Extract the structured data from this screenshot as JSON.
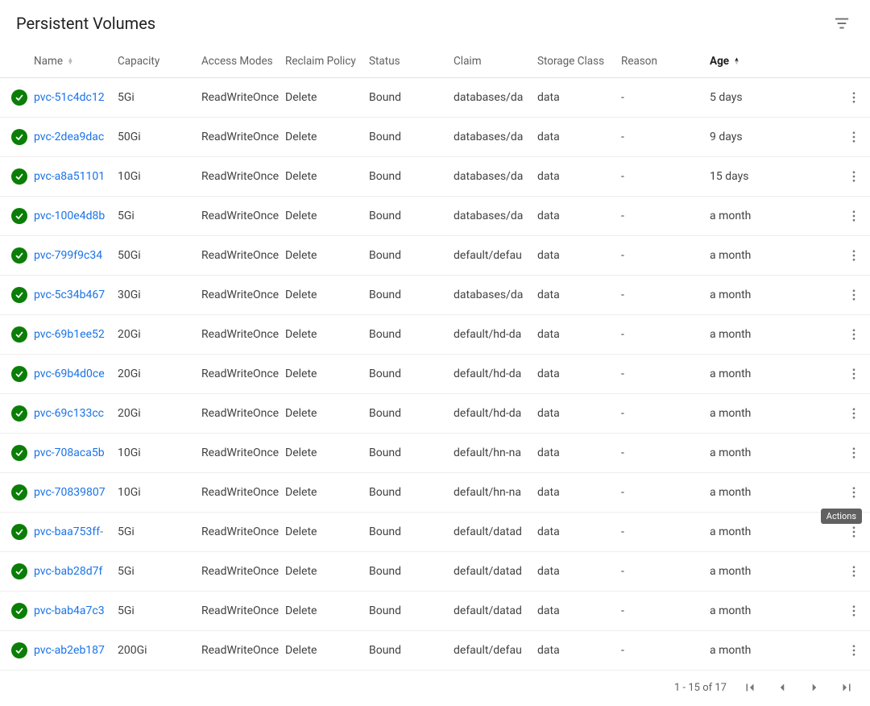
{
  "header": {
    "title": "Persistent Volumes"
  },
  "columns": {
    "name": "Name",
    "capacity": "Capacity",
    "access": "Access Modes",
    "reclaim": "Reclaim Policy",
    "status": "Status",
    "claim": "Claim",
    "storage": "Storage Class",
    "reason": "Reason",
    "age": "Age"
  },
  "rows": [
    {
      "name": "pvc-51c4dc12",
      "capacity": "5Gi",
      "access": "ReadWriteOnce",
      "reclaim": "Delete",
      "status": "Bound",
      "claim": "databases/da",
      "storage": "data",
      "reason": "-",
      "age": "5 days"
    },
    {
      "name": "pvc-2dea9dac",
      "capacity": "50Gi",
      "access": "ReadWriteOnce",
      "reclaim": "Delete",
      "status": "Bound",
      "claim": "databases/da",
      "storage": "data",
      "reason": "-",
      "age": "9 days"
    },
    {
      "name": "pvc-a8a51101",
      "capacity": "10Gi",
      "access": "ReadWriteOnce",
      "reclaim": "Delete",
      "status": "Bound",
      "claim": "databases/da",
      "storage": "data",
      "reason": "-",
      "age": "15 days"
    },
    {
      "name": "pvc-100e4d8b",
      "capacity": "5Gi",
      "access": "ReadWriteOnce",
      "reclaim": "Delete",
      "status": "Bound",
      "claim": "databases/da",
      "storage": "data",
      "reason": "-",
      "age": "a month"
    },
    {
      "name": "pvc-799f9c34",
      "capacity": "50Gi",
      "access": "ReadWriteOnce",
      "reclaim": "Delete",
      "status": "Bound",
      "claim": "default/defau",
      "storage": "data",
      "reason": "-",
      "age": "a month"
    },
    {
      "name": "pvc-5c34b467",
      "capacity": "30Gi",
      "access": "ReadWriteOnce",
      "reclaim": "Delete",
      "status": "Bound",
      "claim": "databases/da",
      "storage": "data",
      "reason": "-",
      "age": "a month"
    },
    {
      "name": "pvc-69b1ee52",
      "capacity": "20Gi",
      "access": "ReadWriteOnce",
      "reclaim": "Delete",
      "status": "Bound",
      "claim": "default/hd-da",
      "storage": "data",
      "reason": "-",
      "age": "a month"
    },
    {
      "name": "pvc-69b4d0ce",
      "capacity": "20Gi",
      "access": "ReadWriteOnce",
      "reclaim": "Delete",
      "status": "Bound",
      "claim": "default/hd-da",
      "storage": "data",
      "reason": "-",
      "age": "a month"
    },
    {
      "name": "pvc-69c133cc",
      "capacity": "20Gi",
      "access": "ReadWriteOnce",
      "reclaim": "Delete",
      "status": "Bound",
      "claim": "default/hd-da",
      "storage": "data",
      "reason": "-",
      "age": "a month"
    },
    {
      "name": "pvc-708aca5b",
      "capacity": "10Gi",
      "access": "ReadWriteOnce",
      "reclaim": "Delete",
      "status": "Bound",
      "claim": "default/hn-na",
      "storage": "data",
      "reason": "-",
      "age": "a month"
    },
    {
      "name": "pvc-70839807",
      "capacity": "10Gi",
      "access": "ReadWriteOnce",
      "reclaim": "Delete",
      "status": "Bound",
      "claim": "default/hn-na",
      "storage": "data",
      "reason": "-",
      "age": "a month"
    },
    {
      "name": "pvc-baa753ff-",
      "capacity": "5Gi",
      "access": "ReadWriteOnce",
      "reclaim": "Delete",
      "status": "Bound",
      "claim": "default/datad",
      "storage": "data",
      "reason": "-",
      "age": "a month"
    },
    {
      "name": "pvc-bab28d7f",
      "capacity": "5Gi",
      "access": "ReadWriteOnce",
      "reclaim": "Delete",
      "status": "Bound",
      "claim": "default/datad",
      "storage": "data",
      "reason": "-",
      "age": "a month"
    },
    {
      "name": "pvc-bab4a7c3",
      "capacity": "5Gi",
      "access": "ReadWriteOnce",
      "reclaim": "Delete",
      "status": "Bound",
      "claim": "default/datad",
      "storage": "data",
      "reason": "-",
      "age": "a month"
    },
    {
      "name": "pvc-ab2eb187",
      "capacity": "200Gi",
      "access": "ReadWriteOnce",
      "reclaim": "Delete",
      "status": "Bound",
      "claim": "default/defau",
      "storage": "data",
      "reason": "-",
      "age": "a month"
    }
  ],
  "pagination": {
    "label": "1 - 15 of 17"
  },
  "tooltip": {
    "actions": "Actions"
  }
}
